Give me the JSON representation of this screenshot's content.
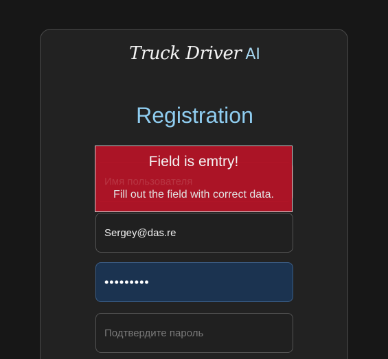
{
  "brand": {
    "name": "Truck Driver",
    "suffix": "AI"
  },
  "form": {
    "title": "Registration",
    "username": {
      "placeholder": "Имя пользователя",
      "value": ""
    },
    "email": {
      "placeholder": "",
      "value": "Sergey@das.re"
    },
    "password": {
      "value": "•••••••••"
    },
    "confirm_password": {
      "placeholder": "Подтвердите пароль",
      "value": ""
    }
  },
  "error": {
    "title": "Field is emtry!",
    "detail": "Fill out the field with correct data."
  },
  "colors": {
    "background": "#171717",
    "card": "#222222",
    "accent": "#8fcdf0",
    "error": "#b31427",
    "focused_field": "#1b3350"
  }
}
